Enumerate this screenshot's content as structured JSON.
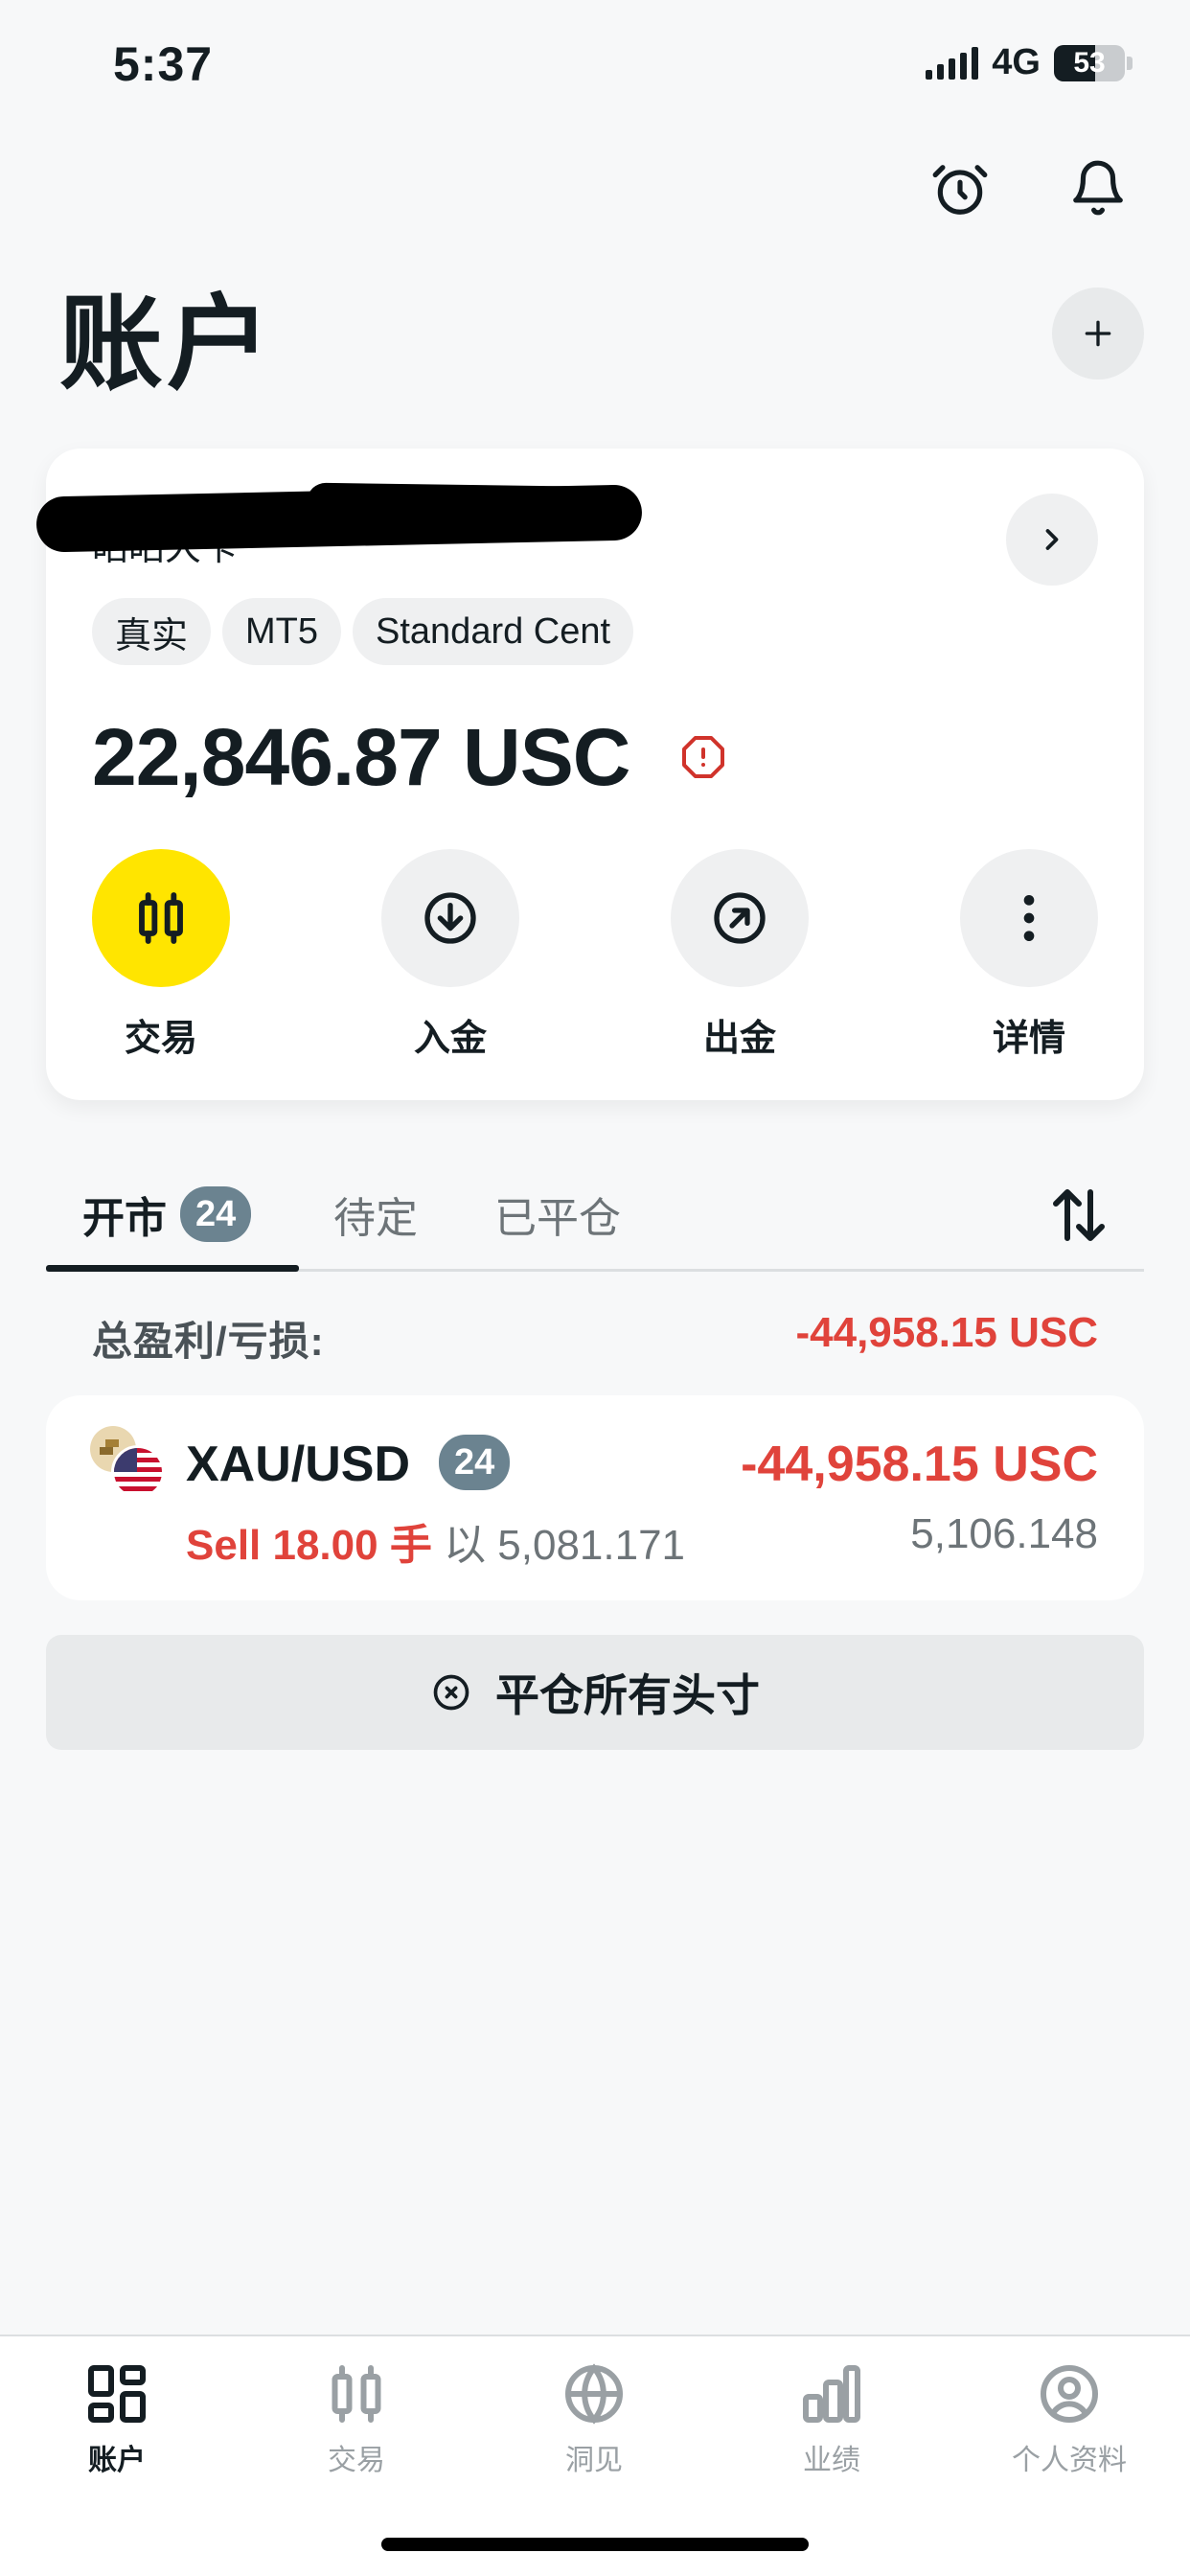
{
  "status": {
    "time": "5:37",
    "network": "4G",
    "battery": "53"
  },
  "header": {
    "title": "账户"
  },
  "account": {
    "name": "昭昭大卡",
    "tags": [
      "真实",
      "MT5",
      "Standard Cent"
    ],
    "balance": "22,846.87 USC",
    "actions": [
      {
        "label": "交易",
        "icon": "candlestick-icon"
      },
      {
        "label": "入金",
        "icon": "arrow-down-circle-icon"
      },
      {
        "label": "出金",
        "icon": "arrow-up-right-circle-icon"
      },
      {
        "label": "详情",
        "icon": "more-vertical-icon"
      }
    ]
  },
  "tabs": {
    "open": {
      "label": "开市",
      "count": "24"
    },
    "pending": {
      "label": "待定"
    },
    "closed": {
      "label": "已平仓"
    }
  },
  "summary": {
    "label": "总盈利/亏损:",
    "value": "-44,958.15 USC"
  },
  "position": {
    "symbol": "XAU/USD",
    "count": "24",
    "pnl": "-44,958.15 USC",
    "side": "Sell 18.00 手",
    "at": "以 5,081.171",
    "current_price": "5,106.148"
  },
  "close_all_label": "平仓所有头寸",
  "nav": [
    {
      "label": "账户",
      "icon": "grid-icon"
    },
    {
      "label": "交易",
      "icon": "candlestick-icon"
    },
    {
      "label": "洞见",
      "icon": "globe-icon"
    },
    {
      "label": "业绩",
      "icon": "bar-chart-icon"
    },
    {
      "label": "个人资料",
      "icon": "profile-icon"
    }
  ],
  "colors": {
    "accent": "#ffe500",
    "loss": "#e0433b",
    "badge": "#6b8390"
  }
}
